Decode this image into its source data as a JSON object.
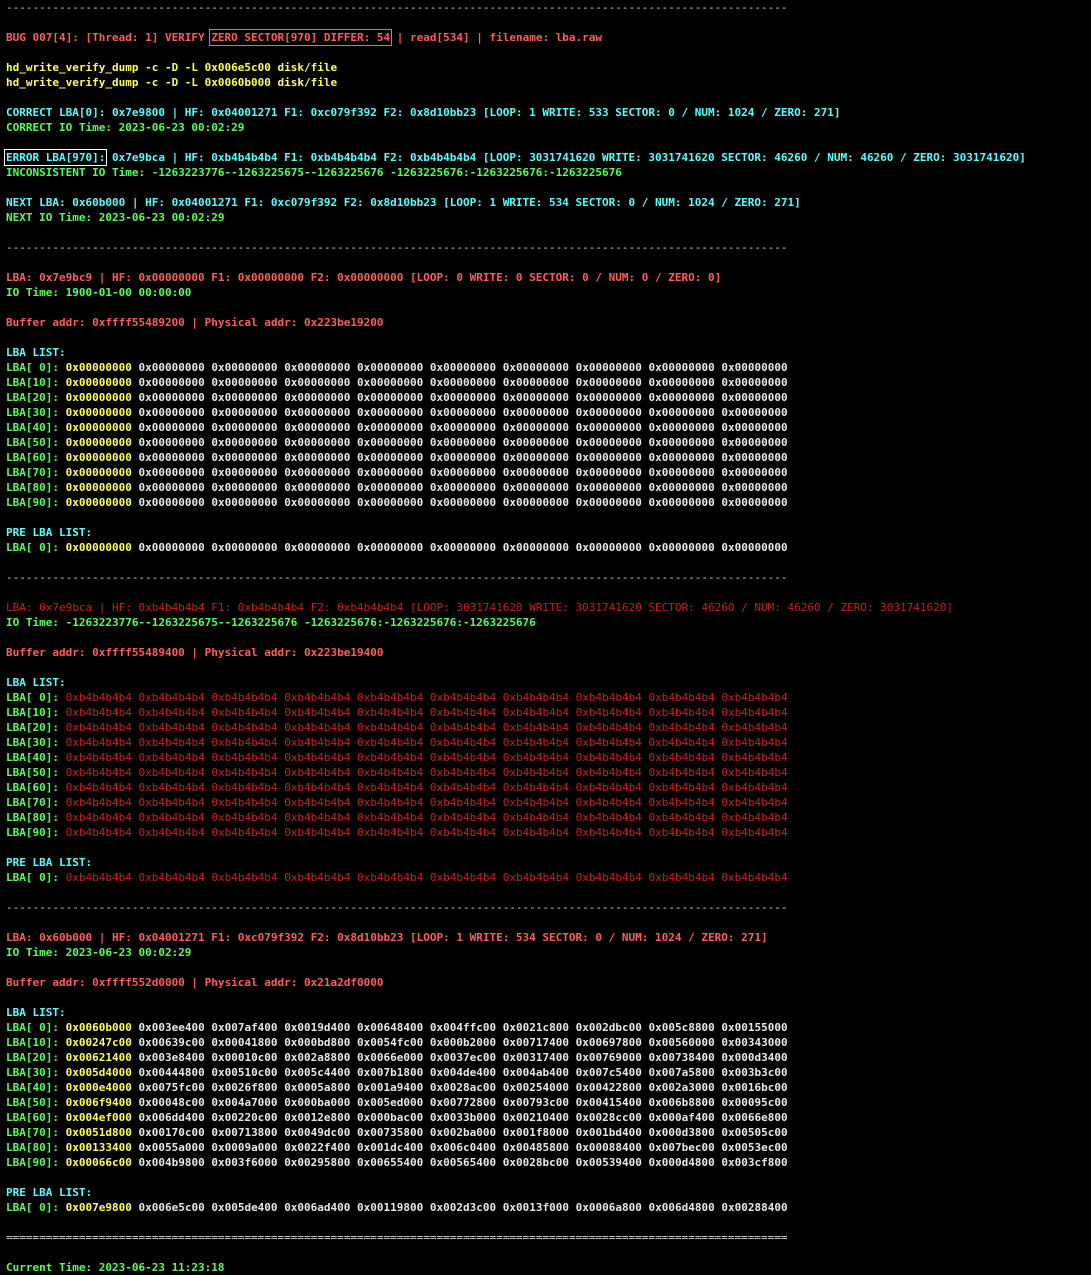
{
  "separator": "----------------------------------------------------------------------------------------------------------------------",
  "separator_double": "======================================================================================================================",
  "bug": {
    "prefix": "BUG 007[4]: [Thread: 1] VERIFY ",
    "boxed": "ZERO SECTOR[970] DIFFER: 54",
    "suffix": " | read[534] | filename: lba.raw"
  },
  "commands": [
    "hd_write_verify_dump -c -D -L 0x006e5c00 disk/file",
    "hd_write_verify_dump -c -D -L 0x0060b000 disk/file"
  ],
  "correct": {
    "line1": "CORRECT LBA[0]: 0x7e9800 | HF: 0x04001271 F1: 0xc079f392 F2: 0x8d10bb23 [LOOP: 1 WRITE: 533 SECTOR: 0 / NUM: 1024 / ZERO: 271]",
    "line2": "CORRECT IO Time: 2023-06-23 00:02:29"
  },
  "error": {
    "boxed": "ERROR LBA[970]:",
    "line1_rest": " 0x7e9bca | HF: 0xb4b4b4b4 F1: 0xb4b4b4b4 F2: 0xb4b4b4b4 [LOOP: 3031741620 WRITE: 3031741620 SECTOR: 46260 / NUM: 46260 / ZERO: 3031741620]",
    "line2": "INCONSISTENT IO Time: -1263223776--1263225675--1263225676 -1263225676:-1263225676:-1263225676"
  },
  "next": {
    "line1": "NEXT LBA: 0x60b000 | HF: 0x04001271 F1: 0xc079f392 F2: 0x8d10bb23 [LOOP: 1 WRITE: 534 SECTOR: 0 / NUM: 1024 / ZERO: 271]",
    "line2": "NEXT IO Time: 2023-06-23 00:02:29"
  },
  "sections": [
    {
      "lba_line": "LBA: 0x7e9bc9 | HF: 0x00000000 F1: 0x00000000 F2: 0x00000000 [LOOP: 0 WRITE: 0 SECTOR: 0 / NUM: 0 / ZERO: 0]",
      "lba_style": "red",
      "io_time": "IO Time: 1900-01-00 00:00:00",
      "buffer": "Buffer addr: 0xffff55489200 | Physical addr: 0x223be19200",
      "list_title": "LBA LIST:",
      "values_style": "wht",
      "first_highlight": true,
      "rows": [
        {
          "label": "LBA[ 0]:",
          "vals": [
            "0x00000000",
            "0x00000000",
            "0x00000000",
            "0x00000000",
            "0x00000000",
            "0x00000000",
            "0x00000000",
            "0x00000000",
            "0x00000000",
            "0x00000000"
          ]
        },
        {
          "label": "LBA[10]:",
          "vals": [
            "0x00000000",
            "0x00000000",
            "0x00000000",
            "0x00000000",
            "0x00000000",
            "0x00000000",
            "0x00000000",
            "0x00000000",
            "0x00000000",
            "0x00000000"
          ]
        },
        {
          "label": "LBA[20]:",
          "vals": [
            "0x00000000",
            "0x00000000",
            "0x00000000",
            "0x00000000",
            "0x00000000",
            "0x00000000",
            "0x00000000",
            "0x00000000",
            "0x00000000",
            "0x00000000"
          ]
        },
        {
          "label": "LBA[30]:",
          "vals": [
            "0x00000000",
            "0x00000000",
            "0x00000000",
            "0x00000000",
            "0x00000000",
            "0x00000000",
            "0x00000000",
            "0x00000000",
            "0x00000000",
            "0x00000000"
          ]
        },
        {
          "label": "LBA[40]:",
          "vals": [
            "0x00000000",
            "0x00000000",
            "0x00000000",
            "0x00000000",
            "0x00000000",
            "0x00000000",
            "0x00000000",
            "0x00000000",
            "0x00000000",
            "0x00000000"
          ]
        },
        {
          "label": "LBA[50]:",
          "vals": [
            "0x00000000",
            "0x00000000",
            "0x00000000",
            "0x00000000",
            "0x00000000",
            "0x00000000",
            "0x00000000",
            "0x00000000",
            "0x00000000",
            "0x00000000"
          ]
        },
        {
          "label": "LBA[60]:",
          "vals": [
            "0x00000000",
            "0x00000000",
            "0x00000000",
            "0x00000000",
            "0x00000000",
            "0x00000000",
            "0x00000000",
            "0x00000000",
            "0x00000000",
            "0x00000000"
          ]
        },
        {
          "label": "LBA[70]:",
          "vals": [
            "0x00000000",
            "0x00000000",
            "0x00000000",
            "0x00000000",
            "0x00000000",
            "0x00000000",
            "0x00000000",
            "0x00000000",
            "0x00000000",
            "0x00000000"
          ]
        },
        {
          "label": "LBA[80]:",
          "vals": [
            "0x00000000",
            "0x00000000",
            "0x00000000",
            "0x00000000",
            "0x00000000",
            "0x00000000",
            "0x00000000",
            "0x00000000",
            "0x00000000",
            "0x00000000"
          ]
        },
        {
          "label": "LBA[90]:",
          "vals": [
            "0x00000000",
            "0x00000000",
            "0x00000000",
            "0x00000000",
            "0x00000000",
            "0x00000000",
            "0x00000000",
            "0x00000000",
            "0x00000000",
            "0x00000000"
          ]
        }
      ],
      "pre_title": "PRE LBA LIST:",
      "pre_row": {
        "label": "LBA[ 0]:",
        "vals": [
          "0x00000000",
          "0x00000000",
          "0x00000000",
          "0x00000000",
          "0x00000000",
          "0x00000000",
          "0x00000000",
          "0x00000000",
          "0x00000000",
          "0x00000000"
        ]
      }
    },
    {
      "lba_line": "LBA: 0x7e9bca | HF: 0xb4b4b4b4 F1: 0xb4b4b4b4 F2: 0xb4b4b4b4 [LOOP: 3031741620 WRITE: 3031741620 SECTOR: 46260 / NUM: 46260 / ZERO: 3031741620]",
      "lba_style": "dim",
      "io_time": "IO Time: -1263223776--1263225675--1263225676 -1263225676:-1263225676:-1263225676",
      "buffer": "Buffer addr: 0xffff55489400 | Physical addr: 0x223be19400",
      "list_title": "LBA LIST:",
      "values_style": "dim",
      "first_highlight": false,
      "rows": [
        {
          "label": "LBA[ 0]:",
          "vals": [
            "0xb4b4b4b4",
            "0xb4b4b4b4",
            "0xb4b4b4b4",
            "0xb4b4b4b4",
            "0xb4b4b4b4",
            "0xb4b4b4b4",
            "0xb4b4b4b4",
            "0xb4b4b4b4",
            "0xb4b4b4b4",
            "0xb4b4b4b4"
          ]
        },
        {
          "label": "LBA[10]:",
          "vals": [
            "0xb4b4b4b4",
            "0xb4b4b4b4",
            "0xb4b4b4b4",
            "0xb4b4b4b4",
            "0xb4b4b4b4",
            "0xb4b4b4b4",
            "0xb4b4b4b4",
            "0xb4b4b4b4",
            "0xb4b4b4b4",
            "0xb4b4b4b4"
          ]
        },
        {
          "label": "LBA[20]:",
          "vals": [
            "0xb4b4b4b4",
            "0xb4b4b4b4",
            "0xb4b4b4b4",
            "0xb4b4b4b4",
            "0xb4b4b4b4",
            "0xb4b4b4b4",
            "0xb4b4b4b4",
            "0xb4b4b4b4",
            "0xb4b4b4b4",
            "0xb4b4b4b4"
          ]
        },
        {
          "label": "LBA[30]:",
          "vals": [
            "0xb4b4b4b4",
            "0xb4b4b4b4",
            "0xb4b4b4b4",
            "0xb4b4b4b4",
            "0xb4b4b4b4",
            "0xb4b4b4b4",
            "0xb4b4b4b4",
            "0xb4b4b4b4",
            "0xb4b4b4b4",
            "0xb4b4b4b4"
          ]
        },
        {
          "label": "LBA[40]:",
          "vals": [
            "0xb4b4b4b4",
            "0xb4b4b4b4",
            "0xb4b4b4b4",
            "0xb4b4b4b4",
            "0xb4b4b4b4",
            "0xb4b4b4b4",
            "0xb4b4b4b4",
            "0xb4b4b4b4",
            "0xb4b4b4b4",
            "0xb4b4b4b4"
          ]
        },
        {
          "label": "LBA[50]:",
          "vals": [
            "0xb4b4b4b4",
            "0xb4b4b4b4",
            "0xb4b4b4b4",
            "0xb4b4b4b4",
            "0xb4b4b4b4",
            "0xb4b4b4b4",
            "0xb4b4b4b4",
            "0xb4b4b4b4",
            "0xb4b4b4b4",
            "0xb4b4b4b4"
          ]
        },
        {
          "label": "LBA[60]:",
          "vals": [
            "0xb4b4b4b4",
            "0xb4b4b4b4",
            "0xb4b4b4b4",
            "0xb4b4b4b4",
            "0xb4b4b4b4",
            "0xb4b4b4b4",
            "0xb4b4b4b4",
            "0xb4b4b4b4",
            "0xb4b4b4b4",
            "0xb4b4b4b4"
          ]
        },
        {
          "label": "LBA[70]:",
          "vals": [
            "0xb4b4b4b4",
            "0xb4b4b4b4",
            "0xb4b4b4b4",
            "0xb4b4b4b4",
            "0xb4b4b4b4",
            "0xb4b4b4b4",
            "0xb4b4b4b4",
            "0xb4b4b4b4",
            "0xb4b4b4b4",
            "0xb4b4b4b4"
          ]
        },
        {
          "label": "LBA[80]:",
          "vals": [
            "0xb4b4b4b4",
            "0xb4b4b4b4",
            "0xb4b4b4b4",
            "0xb4b4b4b4",
            "0xb4b4b4b4",
            "0xb4b4b4b4",
            "0xb4b4b4b4",
            "0xb4b4b4b4",
            "0xb4b4b4b4",
            "0xb4b4b4b4"
          ]
        },
        {
          "label": "LBA[90]:",
          "vals": [
            "0xb4b4b4b4",
            "0xb4b4b4b4",
            "0xb4b4b4b4",
            "0xb4b4b4b4",
            "0xb4b4b4b4",
            "0xb4b4b4b4",
            "0xb4b4b4b4",
            "0xb4b4b4b4",
            "0xb4b4b4b4",
            "0xb4b4b4b4"
          ]
        }
      ],
      "pre_title": "PRE LBA LIST:",
      "pre_row": {
        "label": "LBA[ 0]:",
        "vals": [
          "0xb4b4b4b4",
          "0xb4b4b4b4",
          "0xb4b4b4b4",
          "0xb4b4b4b4",
          "0xb4b4b4b4",
          "0xb4b4b4b4",
          "0xb4b4b4b4",
          "0xb4b4b4b4",
          "0xb4b4b4b4",
          "0xb4b4b4b4"
        ]
      }
    },
    {
      "lba_line": "LBA: 0x60b000 | HF: 0x04001271 F1: 0xc079f392 F2: 0x8d10bb23 [LOOP: 1 WRITE: 534 SECTOR: 0 / NUM: 1024 / ZERO: 271]",
      "lba_style": "red",
      "io_time": "IO Time: 2023-06-23 00:02:29",
      "buffer": "Buffer addr: 0xffff552d0000 | Physical addr: 0x21a2df0000",
      "list_title": "LBA LIST:",
      "values_style": "wht",
      "first_highlight": true,
      "rows": [
        {
          "label": "LBA[ 0]:",
          "vals": [
            "0x0060b000",
            "0x003ee400",
            "0x007af400",
            "0x0019d400",
            "0x00648400",
            "0x004ffc00",
            "0x0021c800",
            "0x002dbc00",
            "0x005c8800",
            "0x00155000"
          ]
        },
        {
          "label": "LBA[10]:",
          "vals": [
            "0x00247c00",
            "0x00639c00",
            "0x00041800",
            "0x000bd800",
            "0x0054fc00",
            "0x000b2000",
            "0x00717400",
            "0x00697800",
            "0x00560000",
            "0x00343000"
          ]
        },
        {
          "label": "LBA[20]:",
          "vals": [
            "0x00621400",
            "0x003e8400",
            "0x00010c00",
            "0x002a8800",
            "0x0066e000",
            "0x0037ec00",
            "0x00317400",
            "0x00769000",
            "0x00738400",
            "0x000d3400"
          ]
        },
        {
          "label": "LBA[30]:",
          "vals": [
            "0x005d4000",
            "0x00444800",
            "0x00510c00",
            "0x005c4400",
            "0x007b1800",
            "0x004de400",
            "0x004ab400",
            "0x007c5400",
            "0x007a5800",
            "0x003b3c00"
          ]
        },
        {
          "label": "LBA[40]:",
          "vals": [
            "0x000e4000",
            "0x0075fc00",
            "0x0026f800",
            "0x0005a800",
            "0x001a9400",
            "0x0028ac00",
            "0x00254000",
            "0x00422800",
            "0x002a3000",
            "0x0016bc00"
          ]
        },
        {
          "label": "LBA[50]:",
          "vals": [
            "0x006f9400",
            "0x00048c00",
            "0x004a7000",
            "0x000ba000",
            "0x005ed000",
            "0x00772800",
            "0x00793c00",
            "0x00415400",
            "0x006b8800",
            "0x00095c00"
          ]
        },
        {
          "label": "LBA[60]:",
          "vals": [
            "0x004ef000",
            "0x006dd400",
            "0x00220c00",
            "0x0012e800",
            "0x000bac00",
            "0x0033b000",
            "0x00210400",
            "0x0028cc00",
            "0x000af400",
            "0x0066e800"
          ]
        },
        {
          "label": "LBA[70]:",
          "vals": [
            "0x0051d800",
            "0x00170c00",
            "0x00713800",
            "0x0049dc00",
            "0x00735800",
            "0x002ba000",
            "0x001f8000",
            "0x001bd400",
            "0x000d3800",
            "0x00505c00"
          ]
        },
        {
          "label": "LBA[80]:",
          "vals": [
            "0x00133400",
            "0x0055a000",
            "0x0009a000",
            "0x0022f400",
            "0x001dc400",
            "0x006c0400",
            "0x00485800",
            "0x00088400",
            "0x007bec00",
            "0x0053ec00"
          ]
        },
        {
          "label": "LBA[90]:",
          "vals": [
            "0x00066c00",
            "0x004b9800",
            "0x003f6000",
            "0x00295800",
            "0x00655400",
            "0x00565400",
            "0x0028bc00",
            "0x00539400",
            "0x000d4800",
            "0x003cf800"
          ]
        }
      ],
      "pre_title": "PRE LBA LIST:",
      "pre_row": {
        "label": "LBA[ 0]:",
        "vals": [
          "0x007e9800",
          "0x006e5c00",
          "0x005de400",
          "0x006ad400",
          "0x00119800",
          "0x002d3c00",
          "0x0013f000",
          "0x0006a800",
          "0x006d4800",
          "0x00288400"
        ]
      }
    }
  ],
  "current_time": "Current Time: 2023-06-23 11:23:18",
  "colors": {
    "background": "#000000",
    "red": "#ff5c5c",
    "dim_red": "#c81e1e",
    "yellow": "#ffff55",
    "green": "#55ff55",
    "cyan": "#55ffff",
    "box_magenta": "#ff44ff"
  }
}
